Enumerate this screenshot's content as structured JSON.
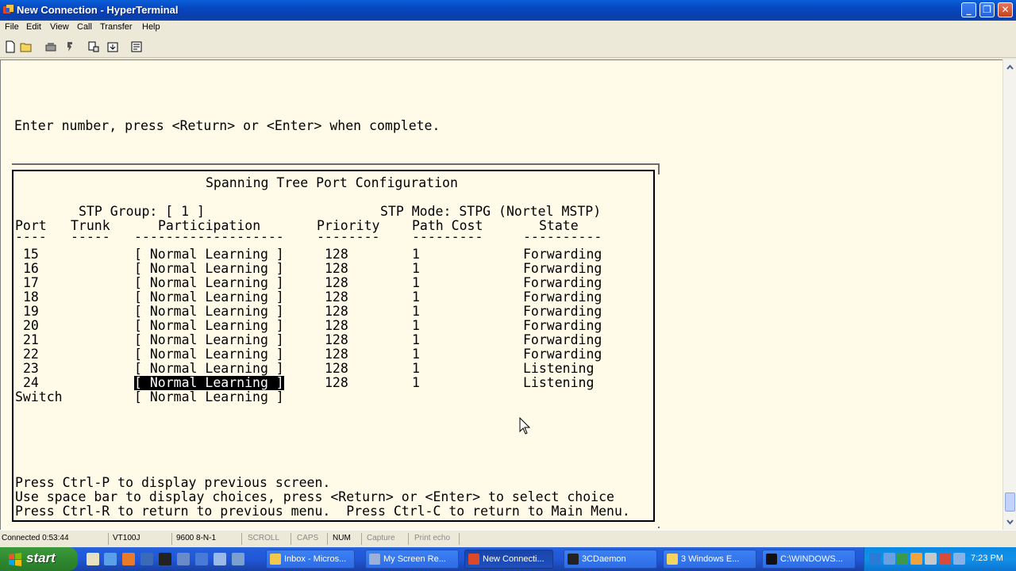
{
  "window": {
    "title": "New Connection - HyperTerminal",
    "minimize": "_",
    "maximize": "❐",
    "close": "✕"
  },
  "menu": [
    "File",
    "Edit",
    "View",
    "Call",
    "Transfer",
    "Help"
  ],
  "toolbar": {
    "icons": [
      "new-icon",
      "open-icon",
      "call-icon",
      "disconnect-icon",
      "send-icon",
      "receive-icon",
      "properties-icon"
    ]
  },
  "terminal": {
    "prompt": "Enter number, press <Return> or <Enter> when complete.",
    "panel_title": "Spanning Tree Port Configuration",
    "stp_group": "STP Group: [ 1 ]",
    "stp_mode": "STP Mode: STPG (Nortel MSTP)",
    "headers": {
      "port": "Port",
      "trunk": "Trunk",
      "participation": "Participation",
      "priority": "Priority",
      "path_cost": "Path Cost",
      "state": "State"
    },
    "underlines": {
      "port": "----",
      "trunk": "-----",
      "participation": "-------------------",
      "priority": "--------",
      "path_cost": "---------",
      "state": "----------"
    },
    "rows": [
      {
        "port": "15",
        "participation": "[ Normal Learning ]",
        "priority": "128",
        "path_cost": "1",
        "state": "Forwarding"
      },
      {
        "port": "16",
        "participation": "[ Normal Learning ]",
        "priority": "128",
        "path_cost": "1",
        "state": "Forwarding"
      },
      {
        "port": "17",
        "participation": "[ Normal Learning ]",
        "priority": "128",
        "path_cost": "1",
        "state": "Forwarding"
      },
      {
        "port": "18",
        "participation": "[ Normal Learning ]",
        "priority": "128",
        "path_cost": "1",
        "state": "Forwarding"
      },
      {
        "port": "19",
        "participation": "[ Normal Learning ]",
        "priority": "128",
        "path_cost": "1",
        "state": "Forwarding"
      },
      {
        "port": "20",
        "participation": "[ Normal Learning ]",
        "priority": "128",
        "path_cost": "1",
        "state": "Forwarding"
      },
      {
        "port": "21",
        "participation": "[ Normal Learning ]",
        "priority": "128",
        "path_cost": "1",
        "state": "Forwarding"
      },
      {
        "port": "22",
        "participation": "[ Normal Learning ]",
        "priority": "128",
        "path_cost": "1",
        "state": "Forwarding"
      },
      {
        "port": "23",
        "participation": "[ Normal Learning ]",
        "priority": "128",
        "path_cost": "1",
        "state": "Listening"
      },
      {
        "port": "24",
        "participation": "[ Normal Learning ]",
        "priority": "128",
        "path_cost": "1",
        "state": "Listening"
      }
    ],
    "switch_row": {
      "port": "Switch",
      "participation": "[ Normal Learning ]"
    },
    "help_lines": [
      "Press Ctrl-P to display previous screen.",
      "Use space bar to display choices, press <Return> or <Enter> to select choice",
      "Press Ctrl-R to return to previous menu.  Press Ctrl-C to return to Main Menu."
    ]
  },
  "statusbar": {
    "connected": "Connected 0:53:44",
    "emulation": "VT100J",
    "settings": "9600 8-N-1",
    "scroll": "SCROLL",
    "caps": "CAPS",
    "num": "NUM",
    "capture": "Capture",
    "print_echo": "Print echo"
  },
  "taskbar": {
    "start": "start",
    "tasks": [
      {
        "label": "Inbox - Micros...",
        "icon": "outlook-icon"
      },
      {
        "label": "My Screen Re...",
        "icon": "recorder-icon"
      },
      {
        "label": "New Connecti...",
        "icon": "hyperterminal-icon"
      },
      {
        "label": "3CDaemon",
        "icon": "3cdaemon-icon"
      },
      {
        "label": "3 Windows E...",
        "icon": "folder-icon"
      },
      {
        "label": "C:\\WINDOWS...",
        "icon": "cmd-icon"
      }
    ],
    "clock": "7:23 PM"
  }
}
